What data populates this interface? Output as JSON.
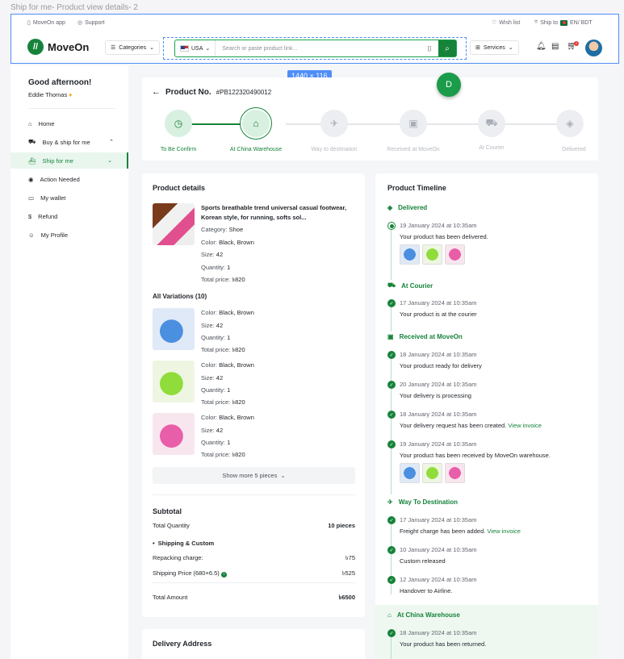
{
  "frame_label": "Ship for me- Product view details- 2",
  "util": {
    "app": "MoveOn app",
    "support": "Support",
    "wishlist": "Wish list",
    "ship_to": "Ship to",
    "locale": "EN/ BDT"
  },
  "header": {
    "logo": "MoveOn",
    "categories": "Categories",
    "country": "USA",
    "search_placeholder": "Search or paste product link...",
    "services": "Services",
    "cart_count": "2"
  },
  "overlay": {
    "dimensions": "1440 × 116",
    "avatar_letter": "D"
  },
  "sidebar": {
    "greeting": "Good afternoon!",
    "user": "Eddie Thomas",
    "items": [
      {
        "label": "Home",
        "icon": "home-icon"
      },
      {
        "label": "Buy & ship for me",
        "icon": "cart-icon"
      },
      {
        "label": "Ship for me",
        "icon": "ship-icon"
      },
      {
        "label": "Action Needed",
        "icon": "alert-icon"
      },
      {
        "label": "My wallet",
        "icon": "wallet-icon"
      },
      {
        "label": "Refund",
        "icon": "refund-icon"
      },
      {
        "label": "My Profile",
        "icon": "user-icon"
      }
    ]
  },
  "progress": {
    "title": "Product No.",
    "number": "#PB122320490012",
    "steps": [
      "To Be Confirm",
      "At China Warehouse",
      "Way to destination",
      "Received at MoveOn",
      "At Courier",
      "Delivered"
    ]
  },
  "product": {
    "section_title": "Product details",
    "name": "Sports breathable trend universal casual footwear, Korean style, for running, softs sol...",
    "category_label": "Category:",
    "category": "Shoe",
    "color_label": "Color:",
    "color": "Black, Brown",
    "size_label": "Size:",
    "size": "42",
    "qty_label": "Quantity:",
    "qty": "1",
    "price_label": "Total price:",
    "price": "৳820",
    "variations_title": "All Variations (10)",
    "variations": [
      {
        "color": "Black, Brown",
        "size": "42",
        "qty": "1",
        "price": "৳820"
      },
      {
        "color": "Black, Brown",
        "size": "42",
        "qty": "1",
        "price": "৳820"
      },
      {
        "color": "Black, Brown",
        "size": "42",
        "qty": "1",
        "price": "৳820"
      }
    ],
    "show_more": "Show more 5 pieces"
  },
  "subtotal": {
    "title": "Subtotal",
    "qty_label": "Total Quantity",
    "qty": "10 pieces",
    "ship_title": "Shipping  & Custom",
    "repack_label": "Repacking charge:",
    "repack": "৳75",
    "shipprice_label": "Shipping Price (680×6.5)",
    "shipprice": "৳525",
    "total_label": "Total Amount",
    "total": "৳6500"
  },
  "delivery": {
    "title": "Delivery Address"
  },
  "timeline": {
    "title": "Product Timeline",
    "view_invoice": "View invoice",
    "groups": [
      {
        "title": "Delivered",
        "events": [
          {
            "date": "19 January 2024 at 10:35am",
            "msg": "Your product has been delivered."
          }
        ]
      },
      {
        "title": "At Courier",
        "events": [
          {
            "date": "17 January 2024 at 10:35am",
            "msg": "Your product is at the courier"
          }
        ]
      },
      {
        "title": "Received at MoveOn",
        "events": [
          {
            "date": "18 January 2024 at 10:35am",
            "msg": "Your product ready for delivery"
          },
          {
            "date": "20 January 2024 at 10:35am",
            "msg": "Your delivery is processing"
          },
          {
            "date": "18 January 2024 at 10:35am",
            "msg": "Your delivery request has been created."
          },
          {
            "date": "19 January 2024 at 10:35am",
            "msg": "Your product has been received by MoveOn warehouse."
          }
        ]
      },
      {
        "title": "Way To Destination",
        "events": [
          {
            "date": "17 January 2024 at 10:35am",
            "msg": "Freight charge has been added."
          },
          {
            "date": "10 January 2024 at 10:35am",
            "msg": "Custom released"
          },
          {
            "date": "12 January 2024 at 10:35am",
            "msg": "Handover to Airline."
          }
        ]
      },
      {
        "title": "At China Warehouse",
        "events": [
          {
            "date": "18 January 2024 at 10:35am",
            "msg": "Your product has been returned."
          }
        ]
      }
    ]
  },
  "colors": {
    "brand": "#16833a",
    "accent_blue": "#4f8ef7"
  }
}
